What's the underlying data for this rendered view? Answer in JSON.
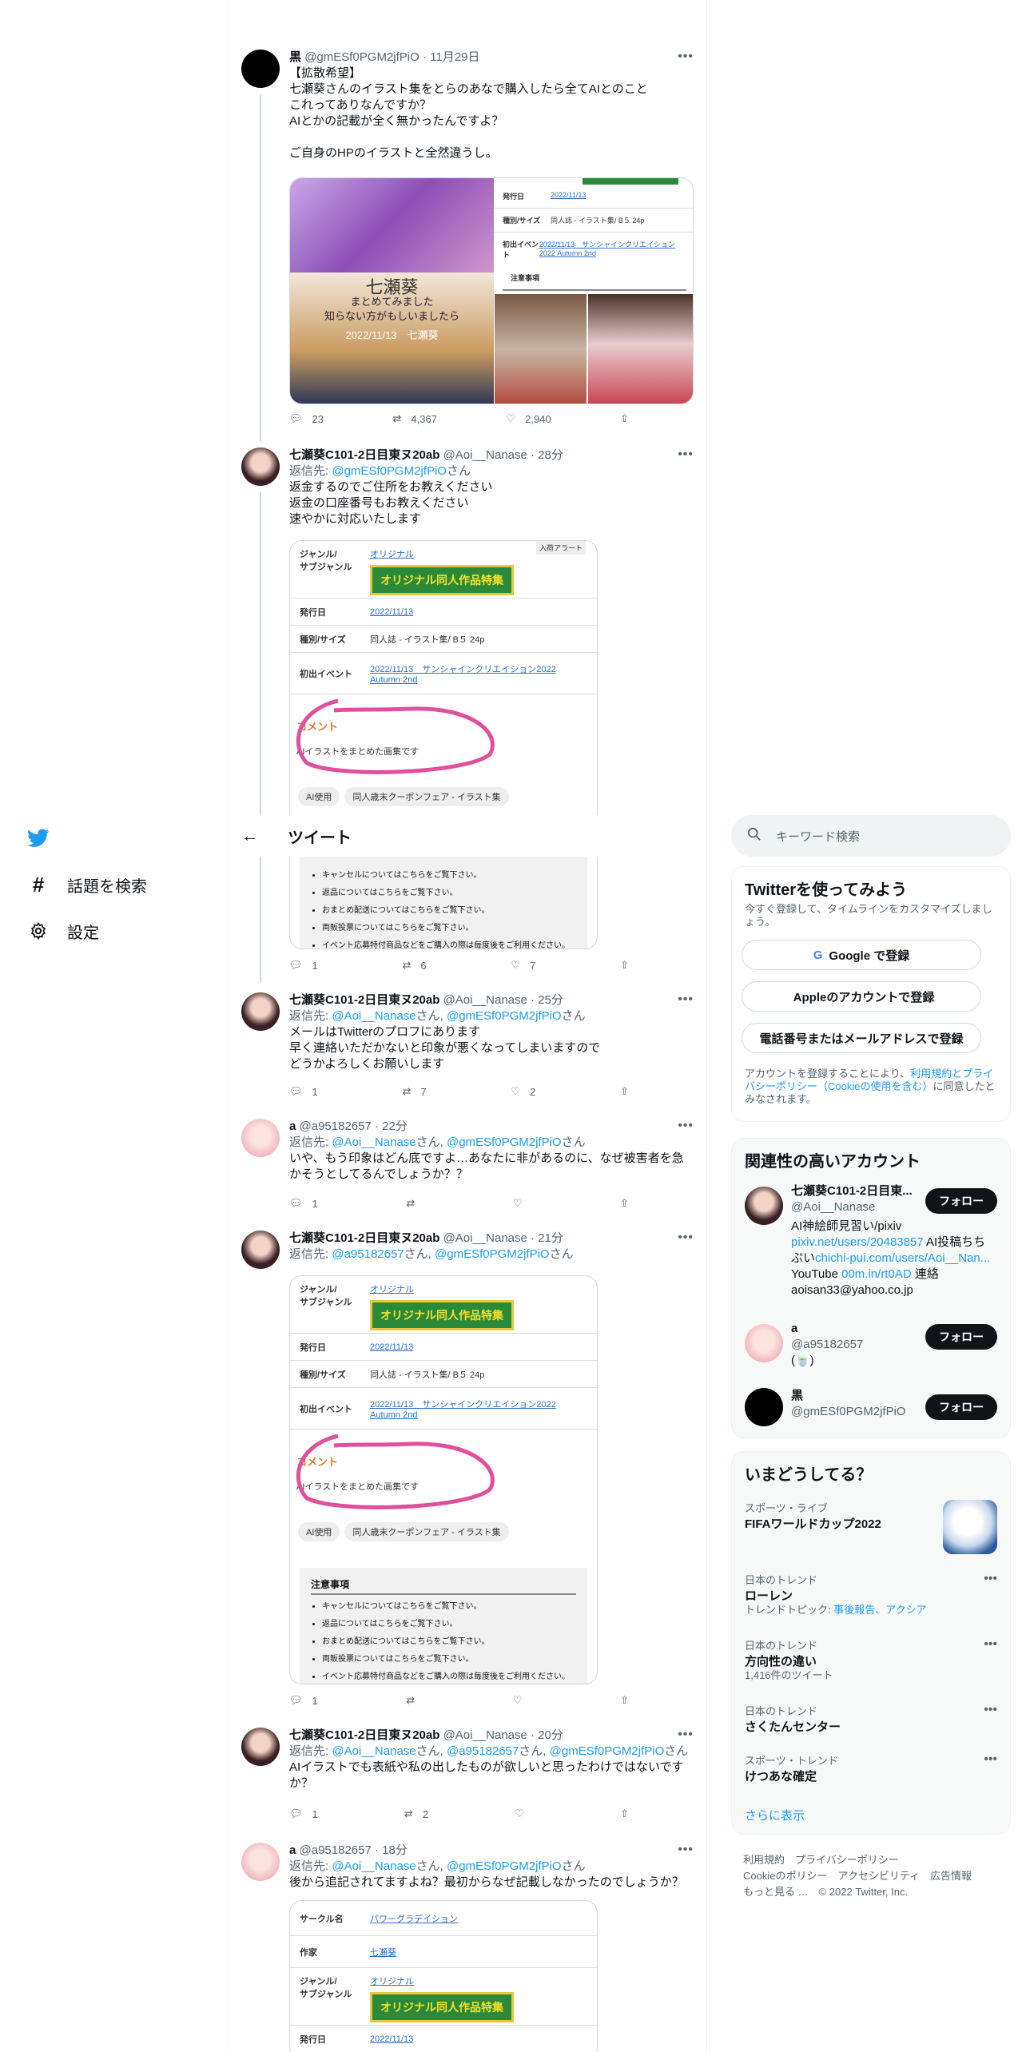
{
  "nav": {
    "logo": "twitter-bird",
    "explore": "話題を検索",
    "settings": "設定"
  },
  "topbar": {
    "title": "ツイート"
  },
  "tweets": [
    {
      "name": "黒",
      "handle": "@gmESf0PGM2jfPiO",
      "time": "11月29日",
      "text": "【拡散希望】\n七瀬葵さんのイラスト集をとらのあなで購入したら全てAIとのこと\nこれってありなんですか？\nAIとかの記載が全く無かったんですよ？\n\nご自身のHPのイラストと全然違うし。",
      "replies": "23",
      "retweets": "4,367",
      "likes": "2,940",
      "media_text": [
        "七瀬葵",
        "まとめてみました",
        "知らない方がもしいましたら",
        "2022/11/13　七瀬葵"
      ],
      "sheet": {
        "date_label": "発行日",
        "date": "2022/11/13",
        "kind_label": "種別/サイズ",
        "kind": "同人誌 - イラスト集/ B５ 24p",
        "event_label": "初出イベント",
        "event": "2022/11/13　サンシャインクリエイション2022 Autumn 2nd",
        "notice": "注意事項"
      }
    },
    {
      "name": "七瀬葵C101-2日目東ヌ20ab",
      "handle": "@Aoi__Nanase",
      "time": "28分",
      "reply_prefix": "返信先:",
      "reply_to": [
        "@gmESf0PGM2jfPiO"
      ],
      "reply_suffix": "さん",
      "text": "返金するのでご住所をお教えください\n返金の口座番号もお教えください\n速やかに対応いたします",
      "replies": "1",
      "retweets": "6",
      "likes": "7"
    },
    {
      "name": "七瀬葵C101-2日目東ヌ20ab",
      "handle": "@Aoi__Nanase",
      "time": "25分",
      "reply_prefix": "返信先:",
      "reply_to": [
        "@Aoi__Nanase",
        "@gmESf0PGM2jfPiO"
      ],
      "reply_suffix": "さん",
      "text": "メールはTwitterのプロフにあります\n早く連絡いただかないと印象が悪くなってしまいますので\nどうかよろしくお願いします",
      "replies": "1",
      "retweets": "7",
      "likes": "2"
    },
    {
      "name": "a",
      "handle": "@a95182657",
      "time": "22分",
      "reply_prefix": "返信先:",
      "reply_to": [
        "@Aoi__Nanase",
        "@gmESf0PGM2jfPiO"
      ],
      "reply_suffix": "さん",
      "text": "いや、もう印象はどん底ですよ…あなたに非があるのに、なぜ被害者を急かそうとしてるんでしょうか？？",
      "replies": "1",
      "retweets": "",
      "likes": ""
    },
    {
      "name": "七瀬葵C101-2日目東ヌ20ab",
      "handle": "@Aoi__Nanase",
      "time": "21分",
      "reply_prefix": "返信先:",
      "reply_to": [
        "@a95182657",
        "@gmESf0PGM2jfPiO"
      ],
      "reply_suffix": "さん",
      "text": "",
      "replies": "1",
      "retweets": "",
      "likes": ""
    },
    {
      "name": "七瀬葵C101-2日目東ヌ20ab",
      "handle": "@Aoi__Nanase",
      "time": "20分",
      "reply_prefix": "返信先:",
      "reply_to": [
        "@Aoi__Nanase",
        "@a95182657",
        "@gmESf0PGM2jfPiO"
      ],
      "reply_suffix": "さん",
      "text": "AIイラストでも表紙や私の出したものが欲しいと思ったわけではないですか？",
      "replies": "1",
      "retweets": "2",
      "likes": ""
    },
    {
      "name": "a",
      "handle": "@a95182657",
      "time": "18分",
      "reply_prefix": "返信先:",
      "reply_to": [
        "@Aoi__Nanase",
        "@gmESf0PGM2jfPiO"
      ],
      "reply_suffix": "さん",
      "text": "後から追記されてますよね？最初からなぜ記載しなかったのでしょうか？",
      "replies": "",
      "retweets": "",
      "likes": ""
    }
  ],
  "sheet_common": {
    "genre_label": "ジャンル/\nサブジャンル",
    "genre": "オリジナル",
    "alert": "入荷アラート",
    "banner": "オリジナル同人作品特集",
    "date_label": "発行日",
    "date": "2022/11/13",
    "kind_label": "種別/サイズ",
    "kind": "同人誌 - イラスト集/ B５ 24p",
    "event_label": "初出イベント",
    "event": "2022/11/13　サンシャインクリエイション2022 Autumn 2nd",
    "comment_label": "コメント",
    "comment": "AIイラストをまとめた画集です",
    "tag1": "AI使用",
    "tag2": "同人歳末クーポンフェア - イラスト集",
    "notice_title": "注意事項",
    "notice_lines": [
      "キャンセルについてはこちらをご覧下さい。",
      "返品についてはこちらをご覧下さい。",
      "おまとめ配送についてはこちらをご覧下さい。",
      "両販投票についてはこちらをご覧下さい。",
      "イベント応募特付商品などをご購入の際は毎度後をご利用ください。詳細はこちらをご覧ください。"
    ],
    "circle_label": "サークル名",
    "circle": "パワーグラデイション",
    "author_label": "作家",
    "author": "七瀬葵"
  },
  "search": {
    "placeholder": "キーワード検索"
  },
  "signup": {
    "title": "Twitterを使ってみよう",
    "desc": "今すぐ登録して、タイムラインをカスタマイズしましょう。",
    "google": "Google で登録",
    "apple": "Appleのアカウントで登録",
    "phone": "電話番号またはメールアドレスで登録",
    "terms_pre": "アカウントを登録することにより、",
    "terms_link": "利用規約とプライバシーポリシー（Cookieの使用を含む）",
    "terms_post": "に同意したとみなされます。"
  },
  "related": {
    "title": "関連性の高いアカウント",
    "follow": "フォロー",
    "accounts": [
      {
        "name": "七瀬葵C101-2日目東...",
        "handle": "@Aoi__Nanase",
        "bio1": "AI神絵師見習い/pixiv",
        "bio_link1": "pixiv.net/users/20483857",
        "bio2": " AI投稿ちちぷい",
        "bio_link2": "chichi-pui.com/users/Aoi__Nan...",
        "bio3": "YouTube ",
        "bio_link3": "00m.in/rt0AD",
        "bio4": " 連絡 aoisan33@yahoo.co.jp"
      },
      {
        "name": "a",
        "handle": "@a95182657",
        "bio1": "(🍵)"
      },
      {
        "name": "黒",
        "handle": "@gmESf0PGM2jfPiO"
      }
    ]
  },
  "trends": {
    "title": "いまどうしてる？",
    "items": [
      {
        "cat": "スポーツ・ライブ",
        "title": "FIFAワールドカップ2022",
        "sub": ""
      },
      {
        "cat": "日本のトレンド",
        "title": "ローレン",
        "sub_pre": "トレンドトピック: ",
        "sub": "事後報告、アクシア"
      },
      {
        "cat": "日本のトレンド",
        "title": "方向性の違い",
        "sub": "1,416件のツイート"
      },
      {
        "cat": "日本のトレンド",
        "title": "さくたんセンター",
        "sub": ""
      },
      {
        "cat": "スポーツ・トレンド",
        "title": "けつあな確定",
        "sub": ""
      }
    ],
    "more": "さらに表示"
  },
  "footer": {
    "line1": "利用規約　プライバシーポリシー",
    "line2": "Cookieのポリシー　アクセシビリティ　広告情報",
    "line3": "もっと見る …　© 2022 Twitter, Inc."
  },
  "colors": {
    "accent": "#1d9bf0",
    "text": "#0f1419",
    "muted": "#536471",
    "comment": "#e6762b"
  }
}
